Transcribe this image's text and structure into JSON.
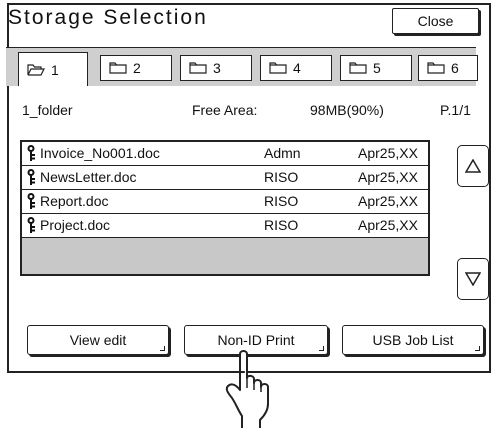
{
  "window": {
    "title": "Storage Selection",
    "close_label": "Close"
  },
  "tabs": [
    {
      "label": "1",
      "active": true
    },
    {
      "label": "2",
      "active": false
    },
    {
      "label": "3",
      "active": false
    },
    {
      "label": "4",
      "active": false
    },
    {
      "label": "5",
      "active": false
    },
    {
      "label": "6",
      "active": false
    }
  ],
  "info": {
    "folder_name": "1_folder",
    "free_area_label": "Free Area:",
    "free_area_value": "98MB(90%)",
    "page": "P.1/1"
  },
  "files": [
    {
      "name": "Invoice_No001.doc",
      "owner": "Admn",
      "date": "Apr25,XX"
    },
    {
      "name": "NewsLetter.doc",
      "owner": "RISO",
      "date": "Apr25,XX"
    },
    {
      "name": "Report.doc",
      "owner": "RISO",
      "date": "Apr25,XX"
    },
    {
      "name": "Project.doc",
      "owner": "RISO",
      "date": "Apr25,XX"
    }
  ],
  "buttons": {
    "view_edit": "View edit",
    "non_id_print": "Non-ID Print",
    "usb_job_list": "USB Job List"
  },
  "icons": {
    "tab": "folder-icon",
    "file": "key-icon",
    "scroll_up": "triangle-up-icon",
    "scroll_down": "triangle-down-icon",
    "pointer": "pointing-hand-icon"
  }
}
